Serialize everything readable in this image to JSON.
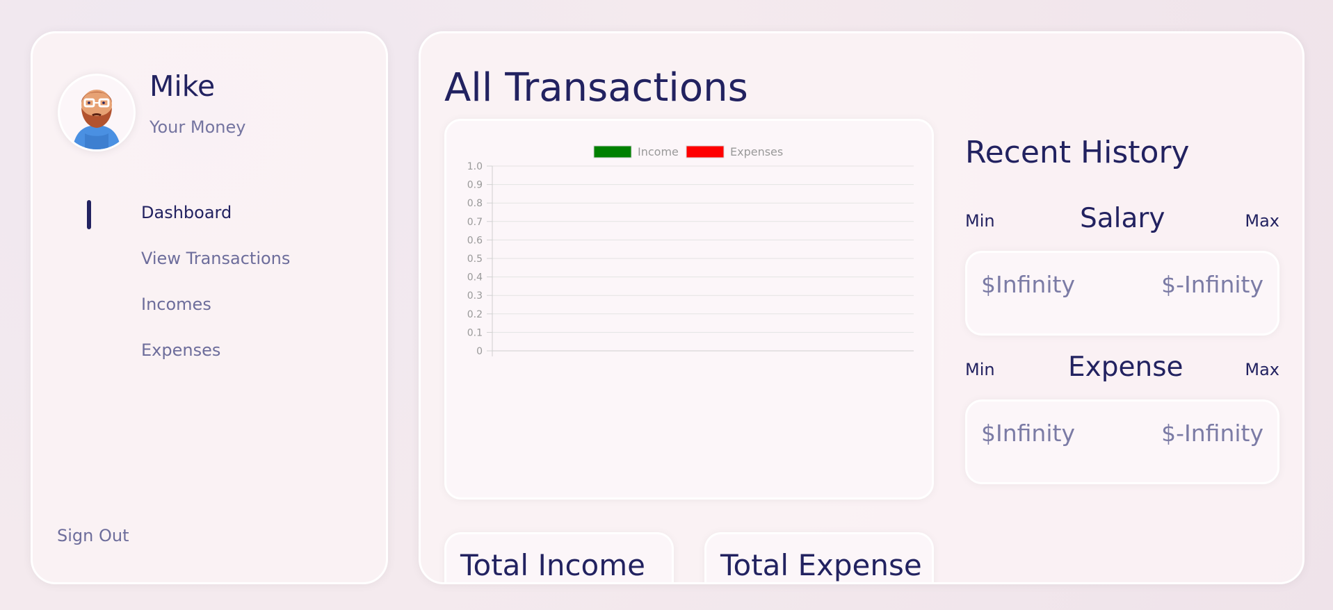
{
  "user": {
    "name": "Mike",
    "subtitle": "Your Money"
  },
  "sidebar": {
    "items": [
      {
        "label": "Dashboard",
        "active": true
      },
      {
        "label": "View Transactions",
        "active": false
      },
      {
        "label": "Incomes",
        "active": false
      },
      {
        "label": "Expenses",
        "active": false
      }
    ],
    "signout_label": "Sign Out"
  },
  "main": {
    "title": "All Transactions",
    "recent_history_title": "Recent History",
    "salary_section": {
      "min_label": "Min",
      "title": "Salary",
      "max_label": "Max",
      "min_value": "$Infinity",
      "max_value": "$-Infinity"
    },
    "expense_section": {
      "min_label": "Min",
      "title": "Expense",
      "max_label": "Max",
      "min_value": "$Infinity",
      "max_value": "$-Infinity"
    },
    "totals": {
      "income_title": "Total Income",
      "expense_title": "Total Expense"
    }
  },
  "colors": {
    "primary": "#222260",
    "muted": "#6d6d9b",
    "income": "#008000",
    "expenses": "#ff0000",
    "panel_bg": "#faf2f5",
    "card_bg": "#fcf6f9",
    "border": "#ffffff"
  },
  "icons": {
    "avatar": "bearded-man-avatar-icon"
  },
  "chart_data": {
    "type": "line",
    "series": [
      {
        "name": "Income",
        "values": []
      },
      {
        "name": "Expenses",
        "values": []
      }
    ],
    "ylim": [
      0,
      1.0
    ],
    "yticks": [
      "1.0",
      "0.9",
      "0.8",
      "0.7",
      "0.6",
      "0.5",
      "0.4",
      "0.3",
      "0.2",
      "0.1",
      "0"
    ],
    "legend": "top-center",
    "grid": true
  }
}
